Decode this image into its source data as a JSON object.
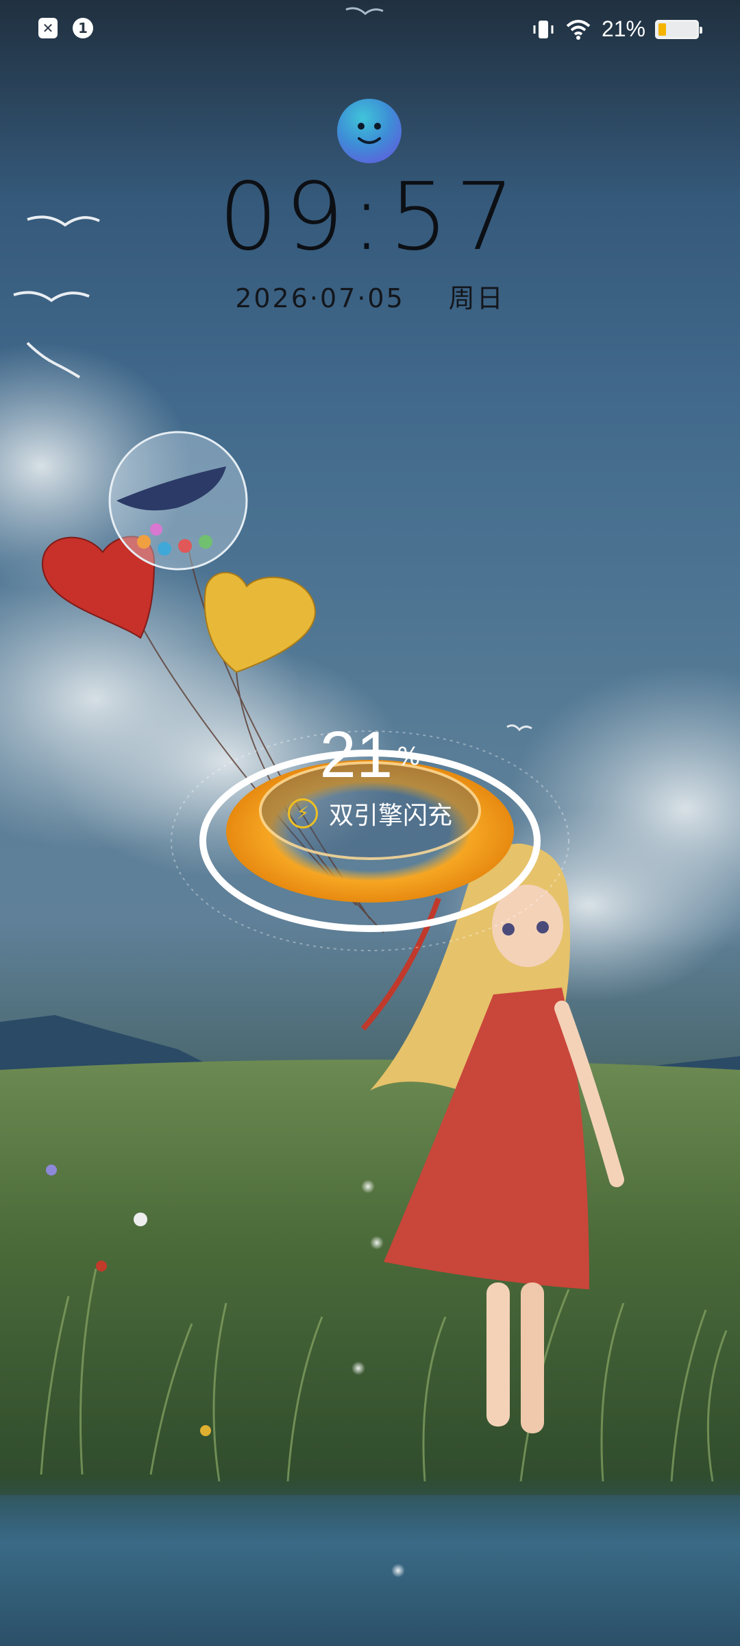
{
  "status_bar": {
    "left_icons": [
      {
        "icon": "sim-x-icon",
        "text": "✕"
      },
      {
        "icon": "notification-count-icon",
        "text": "1"
      }
    ],
    "right_icons": [
      "vibrate-icon",
      "wifi-icon"
    ],
    "battery_text": "21%",
    "battery_level": 0.21,
    "battery_color": "#f4b400"
  },
  "lock": {
    "time": "09:57",
    "date": "2026·07·05",
    "weekday": "周日"
  },
  "charging": {
    "percent": "21",
    "unit": "%",
    "label": "双引擎闪充",
    "ring_color": "#f5a623"
  }
}
